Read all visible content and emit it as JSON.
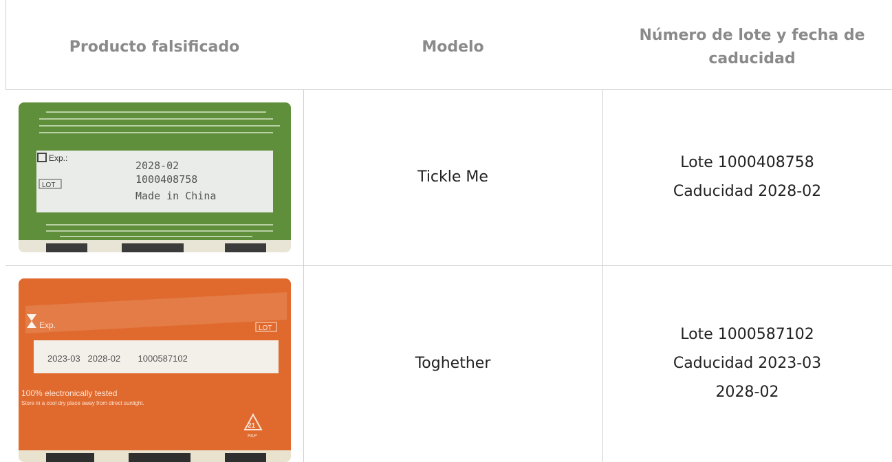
{
  "table": {
    "headers": {
      "product": "Producto falsificado",
      "model": "Modelo",
      "lot": "Número de lote y fecha de caducidad"
    },
    "rows": [
      {
        "model": "Tickle Me",
        "lot_lines": [
          "Lote 1000408758",
          "Caducidad 2028-02"
        ],
        "photo": {
          "box_color": "#5f8f3a",
          "label_exp": "Exp.:",
          "label_lot": "LOT",
          "printed_lines": [
            "2028-02",
            "1000408758",
            "Made in China"
          ]
        }
      },
      {
        "model": "Toghether",
        "lot_lines": [
          "Lote 1000587102",
          "Caducidad 2023-03",
          "2028-02"
        ],
        "photo": {
          "box_color": "#e06a2e",
          "label_exp": "Exp.",
          "label_lot": "LOT",
          "printed_line": "2023-03   2028-02       1000587102",
          "tested_text": "100% electronically tested",
          "storage_text": "Store in a cool dry place away from direct sunlight.",
          "recycle_number": "21",
          "recycle_code": "PAP"
        }
      }
    ]
  }
}
